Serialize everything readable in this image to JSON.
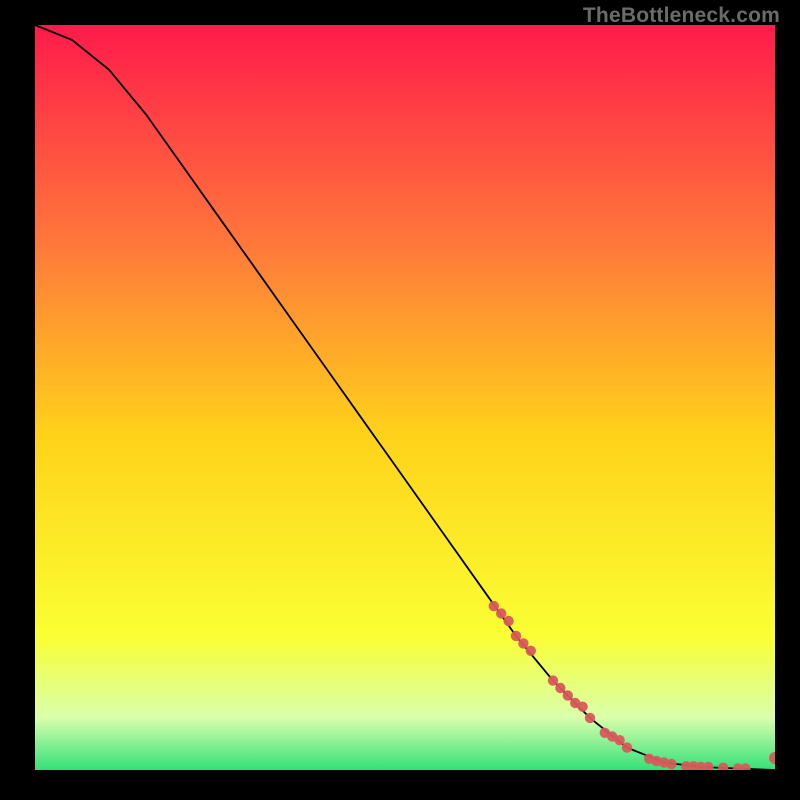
{
  "watermark": "TheBottleneck.com",
  "colors": {
    "gradient_top": "#ff1a4b",
    "gradient_mid1": "#ff7a3a",
    "gradient_mid2": "#ffd21a",
    "gradient_mid3": "#faff33",
    "gradient_band": "#d9ffad",
    "gradient_bottom": "#34e07a",
    "marker": "#d85a5a",
    "line": "#000000"
  },
  "chart_data": {
    "type": "line",
    "title": "",
    "xlabel": "",
    "ylabel": "",
    "xlim": [
      0,
      100
    ],
    "ylim": [
      0,
      100
    ],
    "series": [
      {
        "name": "curve",
        "x": [
          0,
          5,
          10,
          15,
          20,
          25,
          30,
          35,
          40,
          45,
          50,
          55,
          60,
          65,
          70,
          75,
          80,
          85,
          90,
          95,
          100
        ],
        "y": [
          100,
          98,
          94,
          88,
          81,
          74,
          67,
          60,
          53,
          46,
          39,
          32,
          25,
          18,
          12,
          7,
          3,
          1,
          0.4,
          0.2,
          0
        ]
      }
    ],
    "markers": {
      "x": [
        62,
        63,
        64,
        65,
        66,
        67,
        70,
        71,
        72,
        73,
        74,
        75,
        77,
        78,
        79,
        80,
        83,
        84,
        85,
        86,
        88,
        89,
        90,
        91,
        93,
        95,
        96,
        100
      ],
      "y": [
        22,
        21,
        20,
        18,
        17,
        16,
        12,
        11,
        10,
        9,
        8.5,
        7,
        5,
        4.5,
        4,
        3,
        1.5,
        1.2,
        1,
        0.8,
        0.5,
        0.5,
        0.4,
        0.4,
        0.3,
        0.2,
        0.2,
        0
      ]
    }
  }
}
